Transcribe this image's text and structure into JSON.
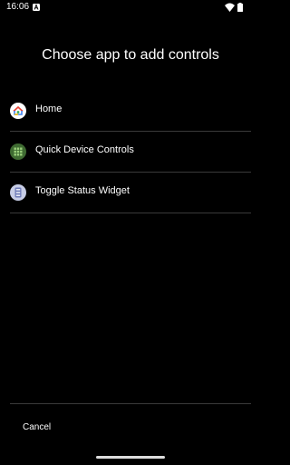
{
  "status_bar": {
    "time": "16:06",
    "icons": [
      "notification-a-icon",
      "wifi-icon",
      "battery-icon"
    ]
  },
  "dialog": {
    "title": "Choose app to add controls",
    "items": [
      {
        "label": "Home",
        "icon": "google-home-icon"
      },
      {
        "label": "Quick Device Controls",
        "icon": "grid-apps-icon"
      },
      {
        "label": "Toggle Status Widget",
        "icon": "toggle-widget-icon"
      }
    ],
    "cancel_label": "Cancel"
  },
  "colors": {
    "background": "#000000",
    "text": "#ffffff",
    "divider": "#3a3a3a"
  }
}
